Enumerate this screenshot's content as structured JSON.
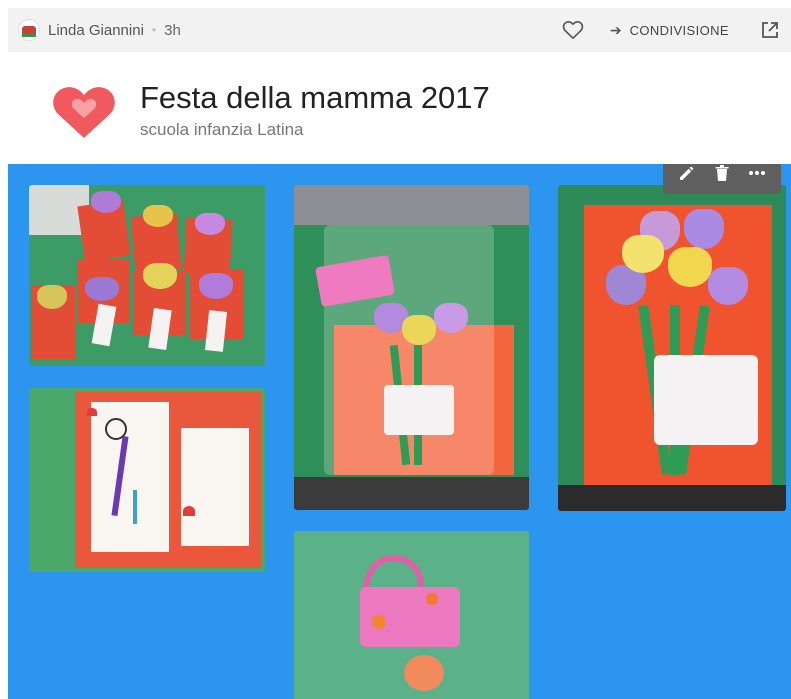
{
  "topbar": {
    "author_name": "Linda Giannini",
    "separator": "•",
    "time_ago": "3h",
    "share_label": "CONDIVISIONE",
    "icons": [
      "avatar",
      "heart-outline-icon",
      "share-arrow-icon",
      "open-external-icon"
    ]
  },
  "post": {
    "title": "Festa della mamma 2017",
    "subtitle": "scuola infanzia Latina",
    "logo_icon": "heart-logo-icon",
    "logo_color": "#f05a5f"
  },
  "toolbar": {
    "icons": [
      "edit-pencil-icon",
      "delete-trash-icon",
      "more-options-icon"
    ]
  },
  "photos": [
    "crafted flower bouquet cards on table",
    "mother's day greeting card open",
    "bouquet in cellophane with handbag",
    "handbag craft with flower",
    "single bouquet on orange card"
  ],
  "colors": {
    "board_bg": "#2b95f0",
    "topbar_bg": "#f2f2f2",
    "toolbar_bg": "#5f5f5f"
  }
}
